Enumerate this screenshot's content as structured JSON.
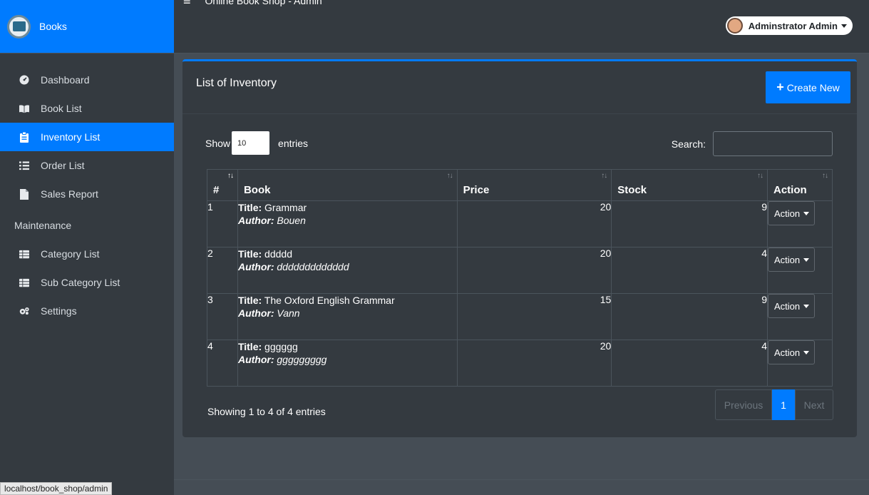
{
  "sidebar": {
    "brand": "Books",
    "items": [
      {
        "label": "Dashboard",
        "icon": "tachometer-icon"
      },
      {
        "label": "Book List",
        "icon": "book-icon"
      },
      {
        "label": "Inventory List",
        "icon": "clipboard-icon",
        "active": true
      },
      {
        "label": "Order List",
        "icon": "list-icon"
      },
      {
        "label": "Sales Report",
        "icon": "file-icon"
      }
    ],
    "section_header": "Maintenance",
    "maint_items": [
      {
        "label": "Category List",
        "icon": "table-icon"
      },
      {
        "label": "Sub Category List",
        "icon": "table-icon"
      },
      {
        "label": "Settings",
        "icon": "cogs-icon"
      }
    ]
  },
  "status_url": "localhost/book_shop/admin",
  "header": {
    "title": "Online Book Shop - Admin",
    "user": "Adminstrator Admin"
  },
  "card": {
    "title": "List of Inventory",
    "create_label": "Create New"
  },
  "table_controls": {
    "show_label": "Show",
    "entries_value": "10",
    "entries_label": "entries",
    "search_label": "Search:"
  },
  "table": {
    "headers": [
      "#",
      "Book",
      "Price",
      "Stock",
      "Action"
    ],
    "title_label": "Title:",
    "author_label": "Author:",
    "action_label": "Action",
    "rows": [
      {
        "num": "1",
        "title": "Grammar",
        "author": "Bouen",
        "price": "20",
        "stock": "9"
      },
      {
        "num": "2",
        "title": "ddddd",
        "author": "ddddddddddddd",
        "price": "20",
        "stock": "4"
      },
      {
        "num": "3",
        "title": "The Oxford English Grammar",
        "author": "Vann",
        "price": "15",
        "stock": "9"
      },
      {
        "num": "4",
        "title": "gggggg",
        "author": "ggggggggg",
        "price": "20",
        "stock": "4"
      }
    ]
  },
  "footer_info": "Showing 1 to 4 of 4 entries",
  "pagination": {
    "previous": "Previous",
    "current": "1",
    "next": "Next"
  },
  "colors": {
    "accent": "#007bff",
    "sidebar": "#343a40",
    "content_bg": "#454d55"
  }
}
